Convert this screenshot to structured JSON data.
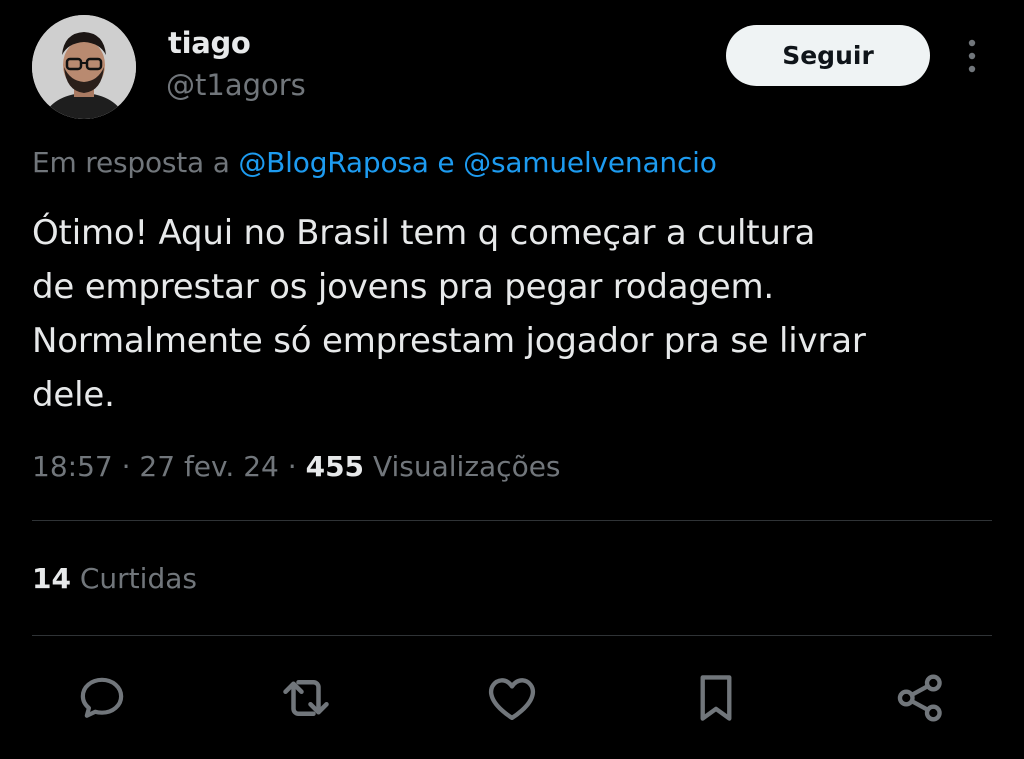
{
  "author": {
    "display_name": "tiago",
    "handle": "@t1agors"
  },
  "follow_label": "Seguir",
  "reply_context": {
    "prefix": "Em resposta a",
    "mention_1": "@BlogRaposa",
    "conjunction": "e",
    "mention_2": "@samuelvenancio"
  },
  "tweet": {
    "lines": [
      "Ótimo! Aqui no Brasil tem q começar a cultura",
      "de emprestar os jovens pra pegar rodagem.",
      "Normalmente só emprestam jogador pra se livrar",
      "dele."
    ]
  },
  "meta": {
    "time": "18:57",
    "separator": "·",
    "date": "27 fev. 24",
    "views_count": "455",
    "views_label": "Visualizações"
  },
  "likes": {
    "count": "14",
    "label": "Curtidas"
  },
  "actions": [
    {
      "icon": "reply-icon"
    },
    {
      "icon": "retweet-icon"
    },
    {
      "icon": "heart-icon"
    },
    {
      "icon": "bookmark-icon"
    },
    {
      "icon": "share-icon"
    }
  ],
  "colors": {
    "background": "#000000",
    "text_primary": "#e7e9ea",
    "text_secondary": "#71767b",
    "link": "#1d9bf0",
    "button_bg": "#eff3f4",
    "divider": "#2f3336"
  }
}
